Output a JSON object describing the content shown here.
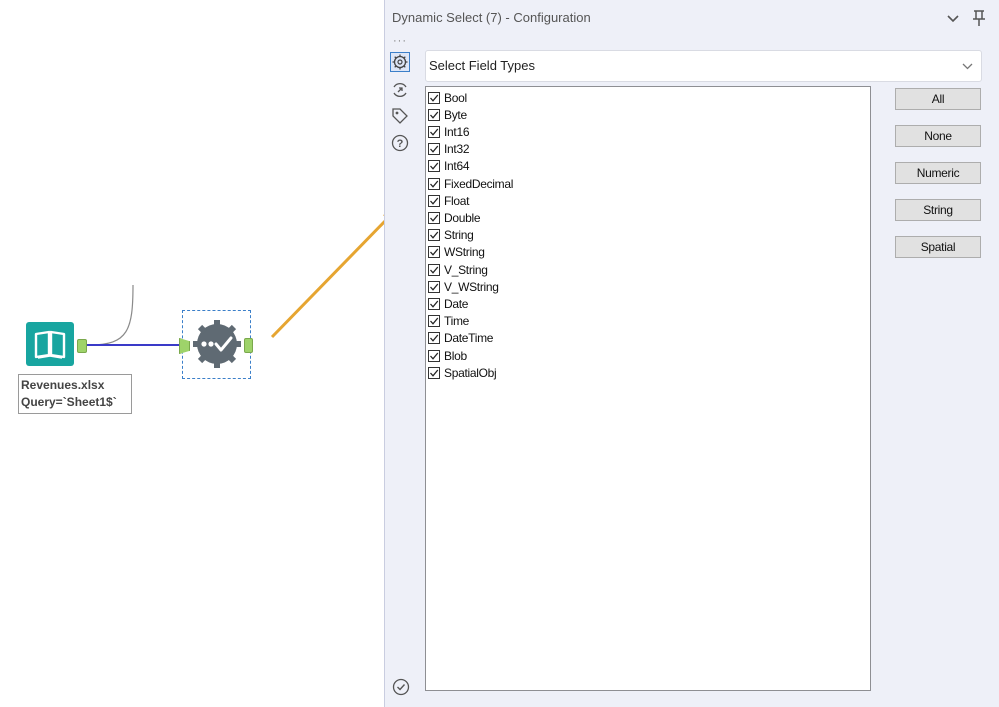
{
  "canvas": {
    "input_tool": {
      "icon": "book-icon",
      "annotation": [
        "Revenues.xlsx",
        "Query=`Sheet1$`"
      ]
    },
    "dynamic_select_tool": {
      "icon": "dynamic-select-icon"
    },
    "colors": {
      "connection": "#3a3ac8",
      "arrow": "#e6a531",
      "input_tool": "#18a5a0",
      "anchor": "#9ed36a"
    }
  },
  "panel": {
    "title": "Dynamic Select (7) - Configuration",
    "header_icons": [
      "chevron-down-icon",
      "pin-icon"
    ],
    "side_icons": [
      "settings-icon",
      "connection-icon",
      "tag-icon",
      "help-icon"
    ],
    "mode_select": {
      "value": "Select Field Types"
    },
    "field_types": [
      {
        "label": "Bool",
        "checked": true
      },
      {
        "label": "Byte",
        "checked": true
      },
      {
        "label": "Int16",
        "checked": true
      },
      {
        "label": "Int32",
        "checked": true
      },
      {
        "label": "Int64",
        "checked": true
      },
      {
        "label": "FixedDecimal",
        "checked": true
      },
      {
        "label": "Float",
        "checked": true
      },
      {
        "label": "Double",
        "checked": true
      },
      {
        "label": "String",
        "checked": true
      },
      {
        "label": "WString",
        "checked": true
      },
      {
        "label": "V_String",
        "checked": true
      },
      {
        "label": "V_WString",
        "checked": true
      },
      {
        "label": "Date",
        "checked": true
      },
      {
        "label": "Time",
        "checked": true
      },
      {
        "label": "DateTime",
        "checked": true
      },
      {
        "label": "Blob",
        "checked": true
      },
      {
        "label": "SpatialObj",
        "checked": true
      }
    ],
    "buttons": [
      "All",
      "None",
      "Numeric",
      "String",
      "Spatial"
    ]
  }
}
